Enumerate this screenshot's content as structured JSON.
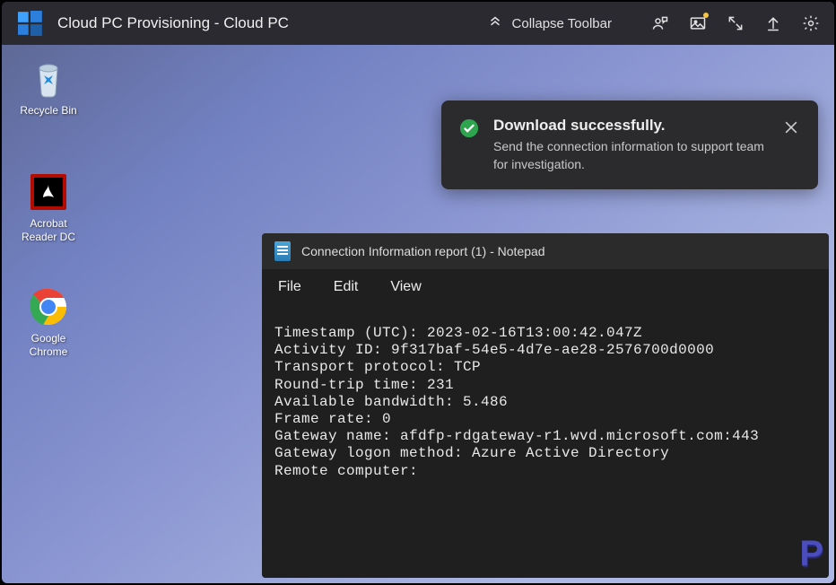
{
  "toolbar": {
    "title": "Cloud PC Provisioning - Cloud PC",
    "collapse_label": "Collapse Toolbar"
  },
  "desktop_icons": {
    "recycle": "Recycle Bin",
    "acrobat": "Acrobat Reader DC",
    "chrome": "Google Chrome"
  },
  "toast": {
    "title": "Download successfully.",
    "message": "Send the connection information to support team for investigation."
  },
  "notepad": {
    "title": "Connection Information report (1) - Notepad",
    "menu": {
      "file": "File",
      "edit": "Edit",
      "view": "View"
    },
    "content": "Timestamp (UTC): 2023-02-16T13:00:42.047Z\nActivity ID: 9f317baf-54e5-4d7e-ae28-2576700d0000\nTransport protocol: TCP\nRound-trip time: 231\nAvailable bandwidth: 5.486\nFrame rate: 0\nGateway name: afdfp-rdgateway-r1.wvd.microsoft.com:443\nGateway logon method: Azure Active Directory\nRemote computer:"
  },
  "watermark": "P"
}
